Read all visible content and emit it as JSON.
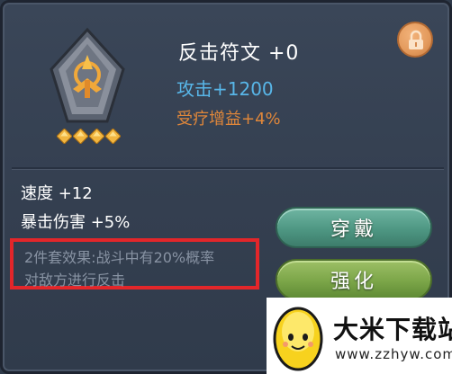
{
  "item": {
    "name": "反击符文 +0",
    "primary_stat": "攻击+1200",
    "secondary_stat": "受疗增益+4%",
    "stars": 4
  },
  "attributes": [
    {
      "label": "速度 +12"
    },
    {
      "label": "暴击伤害 +5%"
    }
  ],
  "set_effect": {
    "line1": "2件套效果:战斗中有20%概率",
    "line2": "对敌方进行反击"
  },
  "buttons": {
    "equip_label": "穿戴",
    "upgrade_label": "强化"
  },
  "watermark": {
    "title": "大米下载站",
    "url": "www.zzhyw.com"
  },
  "colors": {
    "primary_stat": "#58b6e8",
    "secondary_stat": "#e0873a",
    "highlight_box": "#e3262a",
    "equip_button": "#4e9783",
    "upgrade_button": "#7ba548",
    "lock_button": "#e39a5c"
  },
  "icons": {
    "rune": "rune-icon",
    "star": "star-icon",
    "lock": "lock-icon",
    "watermark_logo": "egg-mascot-icon"
  }
}
